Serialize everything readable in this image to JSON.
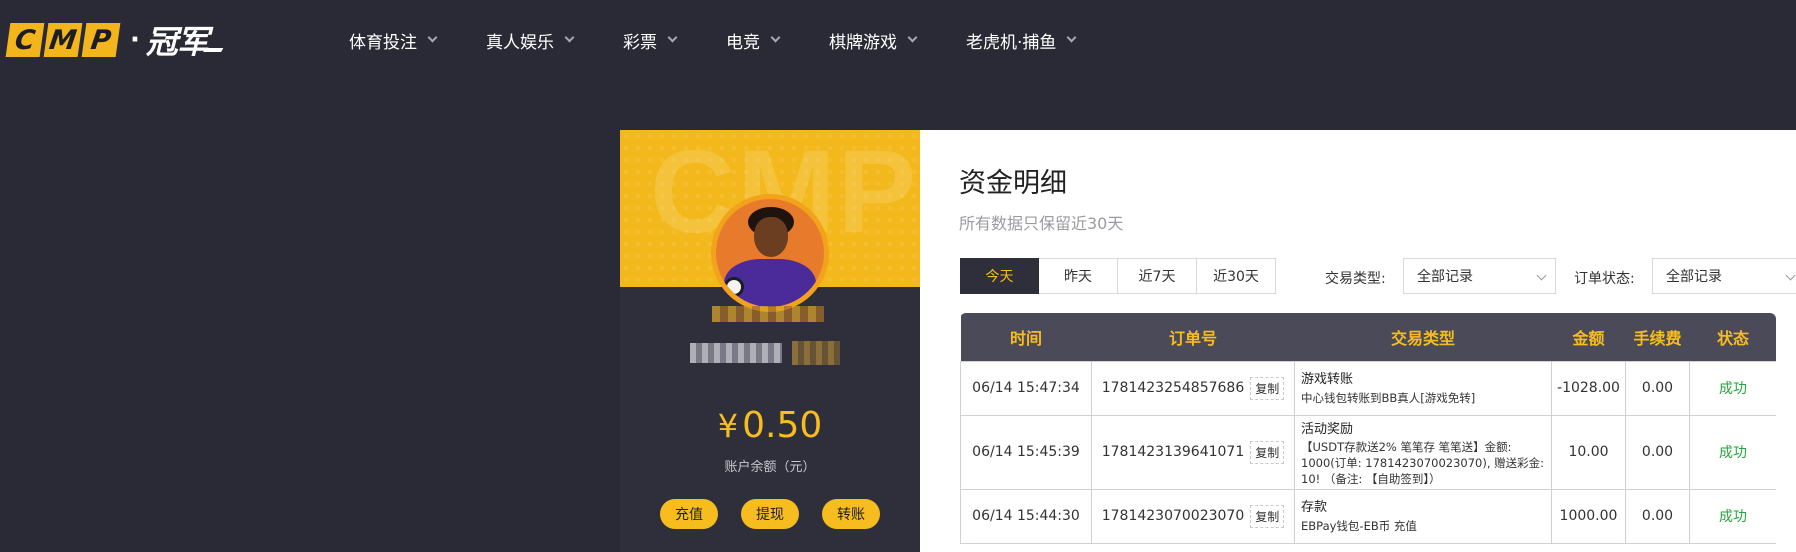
{
  "nav": {
    "logo_letters": [
      "C",
      "M",
      "P"
    ],
    "logo_cn": "冠军",
    "items": [
      {
        "label": "体育投注"
      },
      {
        "label": "真人娱乐"
      },
      {
        "label": "彩票"
      },
      {
        "label": "电竞"
      },
      {
        "label": "棋牌游戏"
      },
      {
        "label": "老虎机·捕鱼"
      }
    ]
  },
  "profile": {
    "banner_watermark": "CMP",
    "currency_symbol": "¥",
    "balance": "0.50",
    "balance_label": "账户余额（元）",
    "actions": [
      {
        "label": "充值"
      },
      {
        "label": "提现"
      },
      {
        "label": "转账"
      }
    ]
  },
  "panel": {
    "title": "资金明细",
    "subtitle": "所有数据只保留近30天",
    "tabs": [
      {
        "label": "今天",
        "active": true
      },
      {
        "label": "昨天",
        "active": false
      },
      {
        "label": "近7天",
        "active": false
      },
      {
        "label": "近30天",
        "active": false
      }
    ],
    "filters": {
      "type_label": "交易类型:",
      "type_value": "全部记录",
      "status_label": "订单状态:",
      "status_value": "全部记录"
    },
    "table": {
      "headers": [
        "时间",
        "订单号",
        "交易类型",
        "金额",
        "手续费",
        "状态"
      ],
      "copy_label": "复制",
      "rows": [
        {
          "time": "06/14 15:47:34",
          "order": "1781423254857686",
          "type_title": "游戏转账",
          "type_detail": "中心钱包转账到BB真人[游戏免转]",
          "amount": "-1028.00",
          "fee": "0.00",
          "status": "成功"
        },
        {
          "time": "06/14 15:45:39",
          "order": "1781423139641071",
          "type_title": "活动奖励",
          "type_detail": "【USDT存款送2% 笔笔存 笔笔送】金额: 1000(订单: 1781423070023070), 赠送彩金: 10! （备注: 【自助签到】）",
          "amount": "10.00",
          "fee": "0.00",
          "status": "成功"
        },
        {
          "time": "06/14 15:44:30",
          "order": "1781423070023070",
          "type_title": "存款",
          "type_detail": "EBPay钱包-EB币 充值",
          "amount": "1000.00",
          "fee": "0.00",
          "status": "成功"
        }
      ]
    }
  },
  "colors": {
    "accent": "#f7bd1e",
    "bg_dark": "#2a2a36",
    "success": "#2aa53a"
  }
}
